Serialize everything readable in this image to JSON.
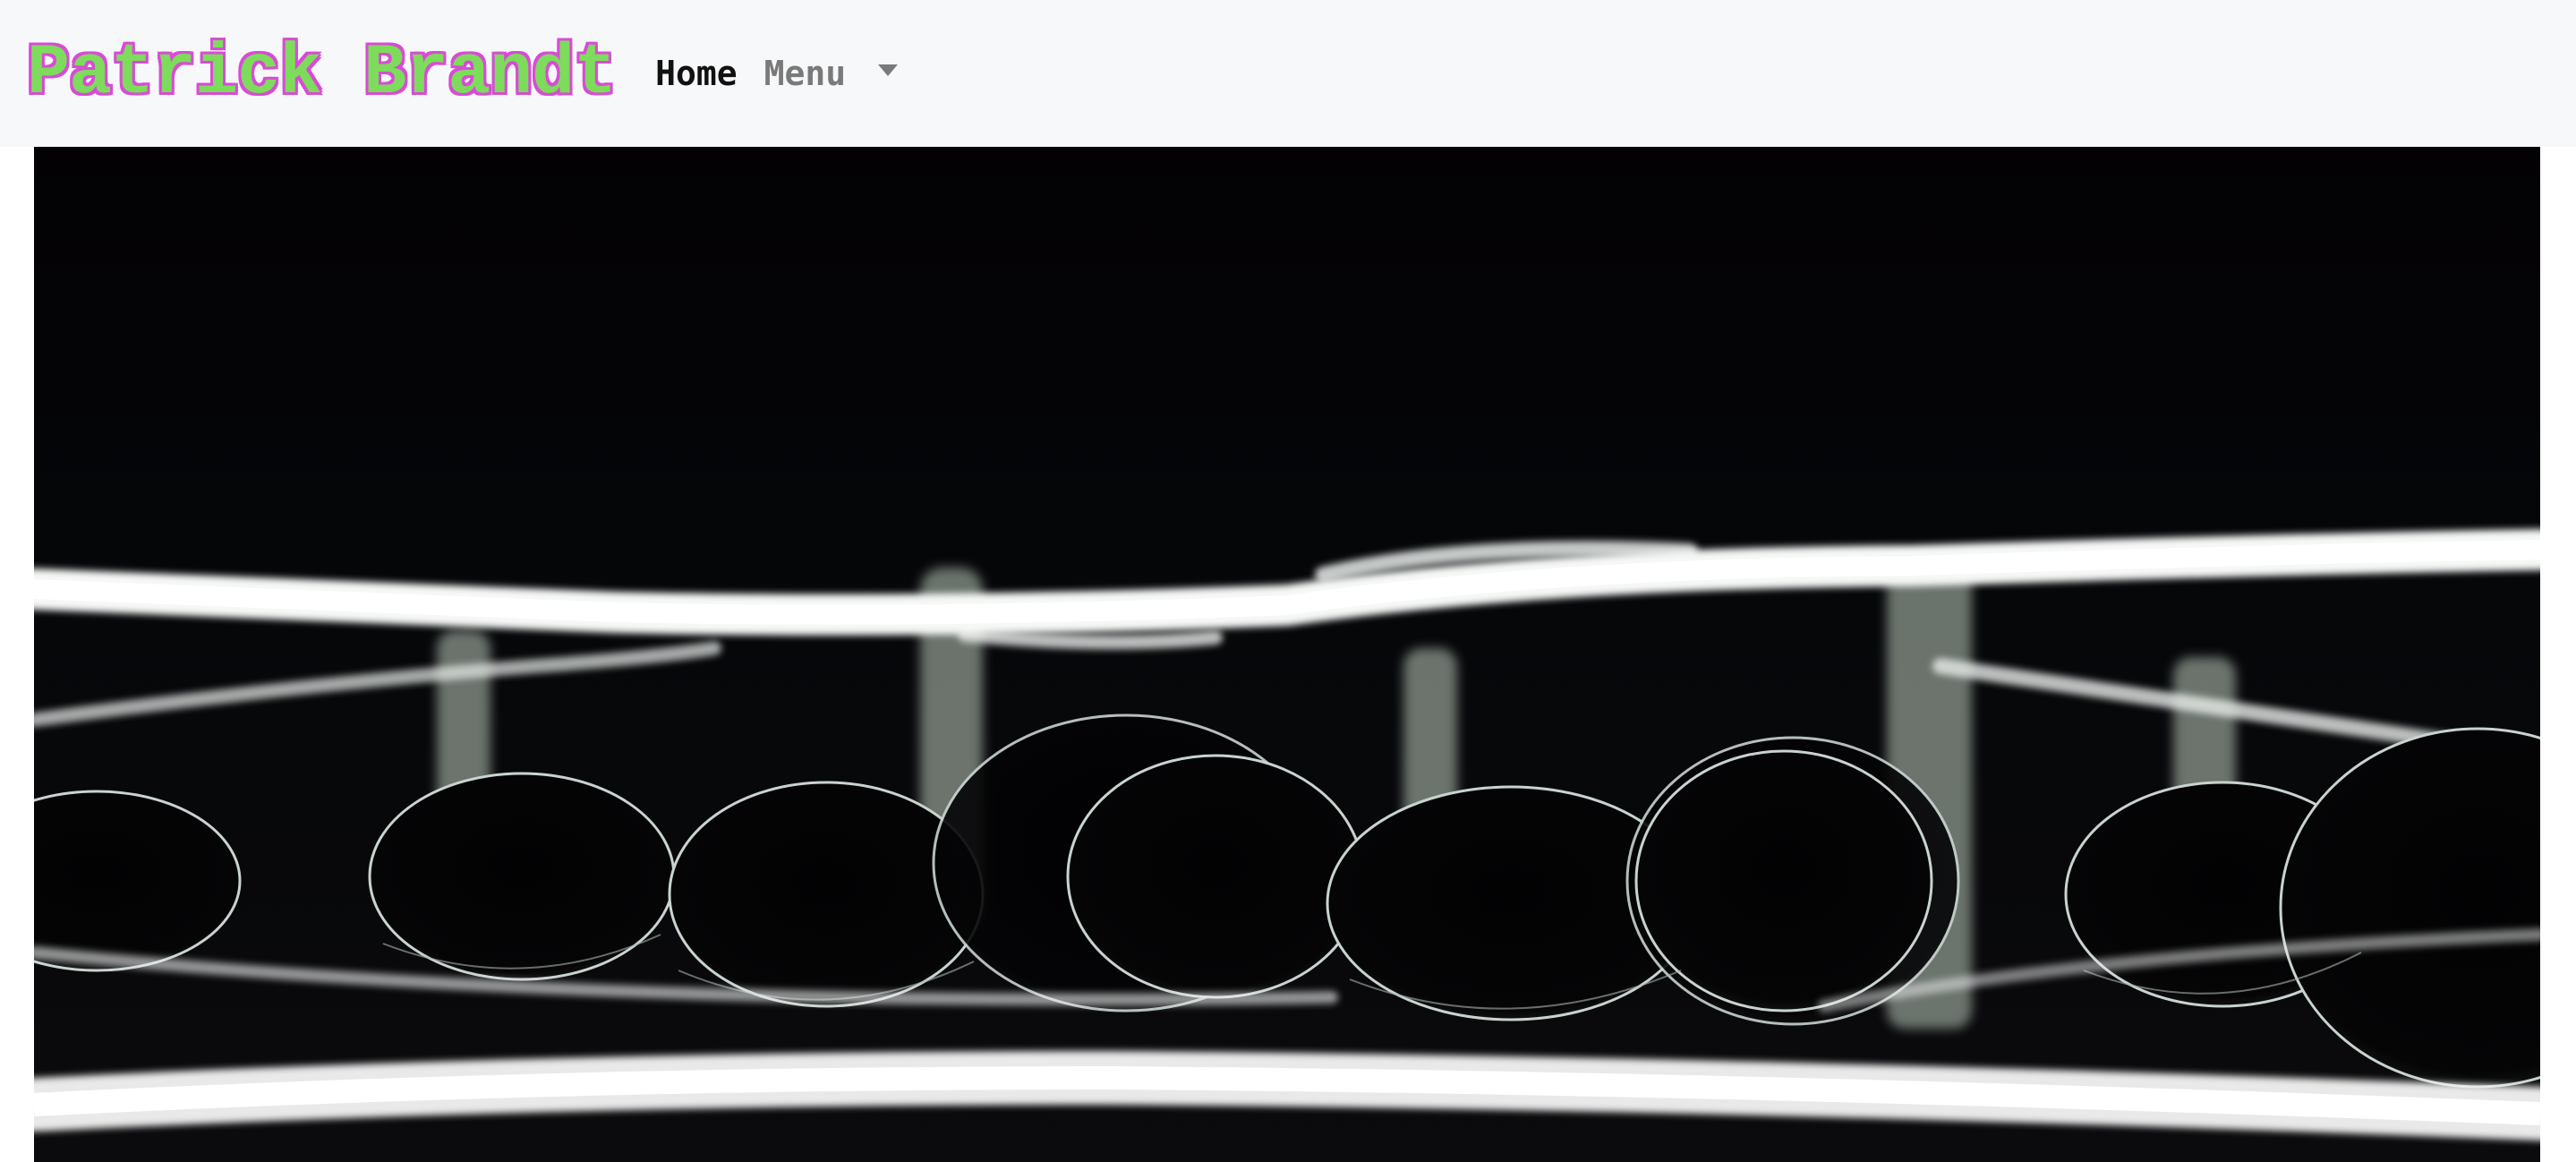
{
  "navbar": {
    "brand": "Patrick Brandt",
    "links": [
      {
        "label": "Home",
        "active": true
      },
      {
        "label": "Menu",
        "dropdown": true
      }
    ]
  },
  "hero": {
    "subject": "water droplets on a dark reflective surface lit by white light strips"
  },
  "colors": {
    "navbar_bg": "#f7f8fa",
    "brand_fill": "#7ddc5c",
    "brand_outline": "#d94bd6",
    "link_active": "#111111",
    "link_muted": "#7a7a7a"
  },
  "icons": [
    "chevron-down-icon"
  ]
}
